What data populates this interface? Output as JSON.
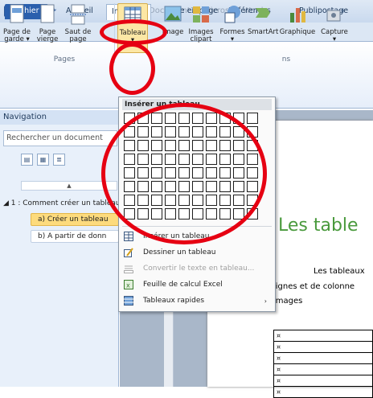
{
  "window": {
    "title": "Document1 - Microsoft Word",
    "app_icon": "W"
  },
  "quick_access": [
    "save-icon",
    "undo-icon",
    "redo-icon"
  ],
  "tabs": [
    {
      "label": "Fichier"
    },
    {
      "label": "Accueil"
    },
    {
      "label": "Insertion"
    },
    {
      "label": "Mise en page"
    },
    {
      "label": "Références"
    },
    {
      "label": "Publipostage"
    }
  ],
  "ribbon": {
    "buttons": [
      {
        "label": "Page de garde ▾",
        "icon": "cover-page-icon"
      },
      {
        "label": "Page vierge",
        "icon": "blank-page-icon"
      },
      {
        "label": "Saut de page",
        "icon": "page-break-icon"
      },
      {
        "label": "Tableau ▾",
        "icon": "table-icon"
      },
      {
        "label": "Image",
        "icon": "picture-icon"
      },
      {
        "label": "Images clipart",
        "icon": "clipart-icon"
      },
      {
        "label": "Formes ▾",
        "icon": "shapes-icon"
      },
      {
        "label": "SmartArt",
        "icon": "smartart-icon"
      },
      {
        "label": "Graphique",
        "icon": "chart-icon"
      },
      {
        "label": "Capture ▾",
        "icon": "screenshot-icon"
      }
    ],
    "groups": [
      {
        "label": "Pages"
      },
      {
        "label": "ns"
      }
    ]
  },
  "navigation": {
    "title": "Navigation",
    "search_placeholder": "Rechercher un document",
    "scroll_up": "▲",
    "headings": [
      {
        "label": "◢ 1 : Comment créer un tableau"
      },
      {
        "label": "a) Créer un tableau"
      },
      {
        "label": "b) A partir de donn"
      }
    ]
  },
  "table_menu": {
    "title": "Insérer un tableau",
    "grid": {
      "columns": 10,
      "rows": 8
    },
    "items": [
      {
        "label": "Insérer un tableau",
        "icon": "insert-table-icon",
        "disabled": false
      },
      {
        "label": "Dessiner un tableau",
        "icon": "draw-table-icon",
        "disabled": false
      },
      {
        "label": "Convertir le texte en tableau...",
        "icon": "convert-text-icon",
        "disabled": true
      },
      {
        "label": "Feuille de calcul Excel",
        "icon": "excel-icon",
        "disabled": false
      },
      {
        "label": "Tableaux rapides",
        "icon": "quick-tables-icon",
        "disabled": false,
        "submenu": "›"
      }
    ]
  },
  "document": {
    "heading": "Les table",
    "lines": [
      "Les tableaux",
      "lignes et de colonne",
      "images"
    ],
    "table_cell": "¤",
    "table_rows": 6
  },
  "colors": {
    "accent": "#2a5fad",
    "annotation": "#e60012",
    "heading": "#4a9a3d"
  }
}
